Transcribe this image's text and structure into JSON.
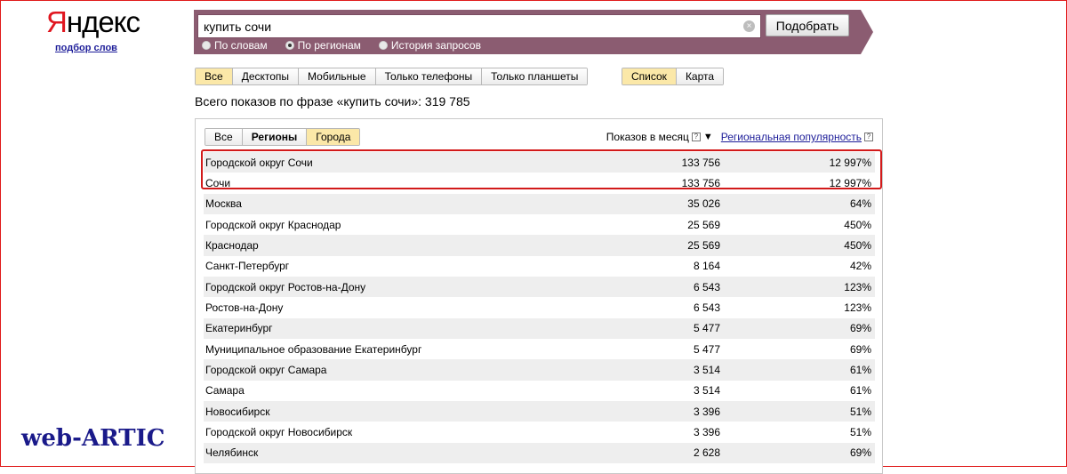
{
  "logo": {
    "first": "Я",
    "rest": "ндекс",
    "subtitle": "подбор слов"
  },
  "search": {
    "value": "купить сочи",
    "button_label": "Подобрать",
    "clear_symbol": "×"
  },
  "modes": [
    {
      "label": "По словам",
      "selected": false
    },
    {
      "label": "По регионам",
      "selected": true
    },
    {
      "label": "История запросов",
      "selected": false
    }
  ],
  "devices": [
    "Все",
    "Десктопы",
    "Мобильные",
    "Только телефоны",
    "Только планшеты"
  ],
  "view": [
    "Список",
    "Карта"
  ],
  "total": "Всего показов по фразе «купить сочи»: 319 785",
  "geo_tabs": [
    "Все",
    "Регионы",
    "Города"
  ],
  "table": {
    "col_shows": "Показов в месяц",
    "col_popularity": "Региональная популярность",
    "help_symbol": "?",
    "sort_symbol": "▼",
    "rows": [
      {
        "name": "Городской округ Сочи",
        "shows": "133 756",
        "pop": "12 997%"
      },
      {
        "name": "Сочи",
        "shows": "133 756",
        "pop": "12 997%"
      },
      {
        "name": "Москва",
        "shows": "35 026",
        "pop": "64%"
      },
      {
        "name": "Городской округ Краснодар",
        "shows": "25 569",
        "pop": "450%"
      },
      {
        "name": "Краснодар",
        "shows": "25 569",
        "pop": "450%"
      },
      {
        "name": "Санкт-Петербург",
        "shows": "8 164",
        "pop": "42%"
      },
      {
        "name": "Городской округ Ростов-на-Дону",
        "shows": "6 543",
        "pop": "123%"
      },
      {
        "name": "Ростов-на-Дону",
        "shows": "6 543",
        "pop": "123%"
      },
      {
        "name": "Екатеринбург",
        "shows": "5 477",
        "pop": "69%"
      },
      {
        "name": "Муниципальное образование Екатеринбург",
        "shows": "5 477",
        "pop": "69%"
      },
      {
        "name": "Городской округ Самара",
        "shows": "3 514",
        "pop": "61%"
      },
      {
        "name": "Самара",
        "shows": "3 514",
        "pop": "61%"
      },
      {
        "name": "Новосибирск",
        "shows": "3 396",
        "pop": "51%"
      },
      {
        "name": "Городской округ Новосибирск",
        "shows": "3 396",
        "pop": "51%"
      },
      {
        "name": "Челябинск",
        "shows": "2 628",
        "pop": "69%"
      }
    ]
  },
  "watermark": {
    "first": "web-",
    "rest": "ARTIC"
  },
  "colors": {
    "band": "#8b5c71",
    "active_tab": "#fbe8a8",
    "highlight": "#d21a1a",
    "link": "#1d1d99"
  }
}
